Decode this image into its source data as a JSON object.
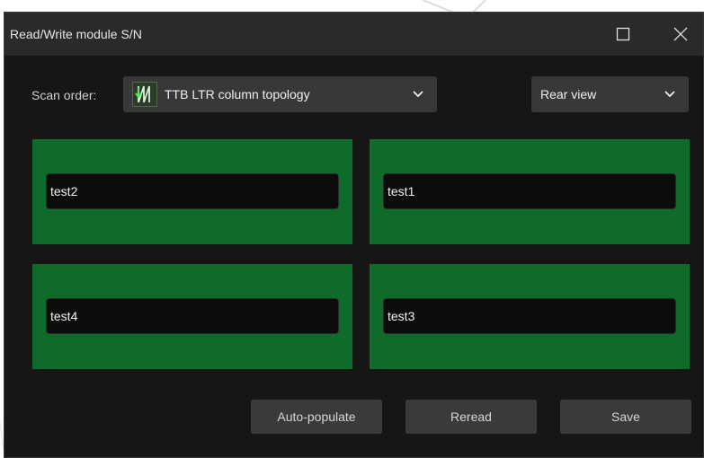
{
  "window": {
    "title": "Read/Write module S/N"
  },
  "scan_order": {
    "label": "Scan order:",
    "selected": "TTB LTR column topology",
    "icon": "column-topology-icon"
  },
  "view": {
    "selected": "Rear view"
  },
  "modules": [
    {
      "serial": "test2"
    },
    {
      "serial": "test1"
    },
    {
      "serial": "test4"
    },
    {
      "serial": "test3"
    }
  ],
  "buttons": {
    "auto_populate": "Auto-populate",
    "reread": "Reread",
    "save": "Save"
  },
  "colors": {
    "window_bg": "#161616",
    "titlebar_bg": "#2a2a2a",
    "module_green": "#0f6b2a",
    "input_bg": "#0c0c0c",
    "button_bg": "#3a3a3a"
  }
}
